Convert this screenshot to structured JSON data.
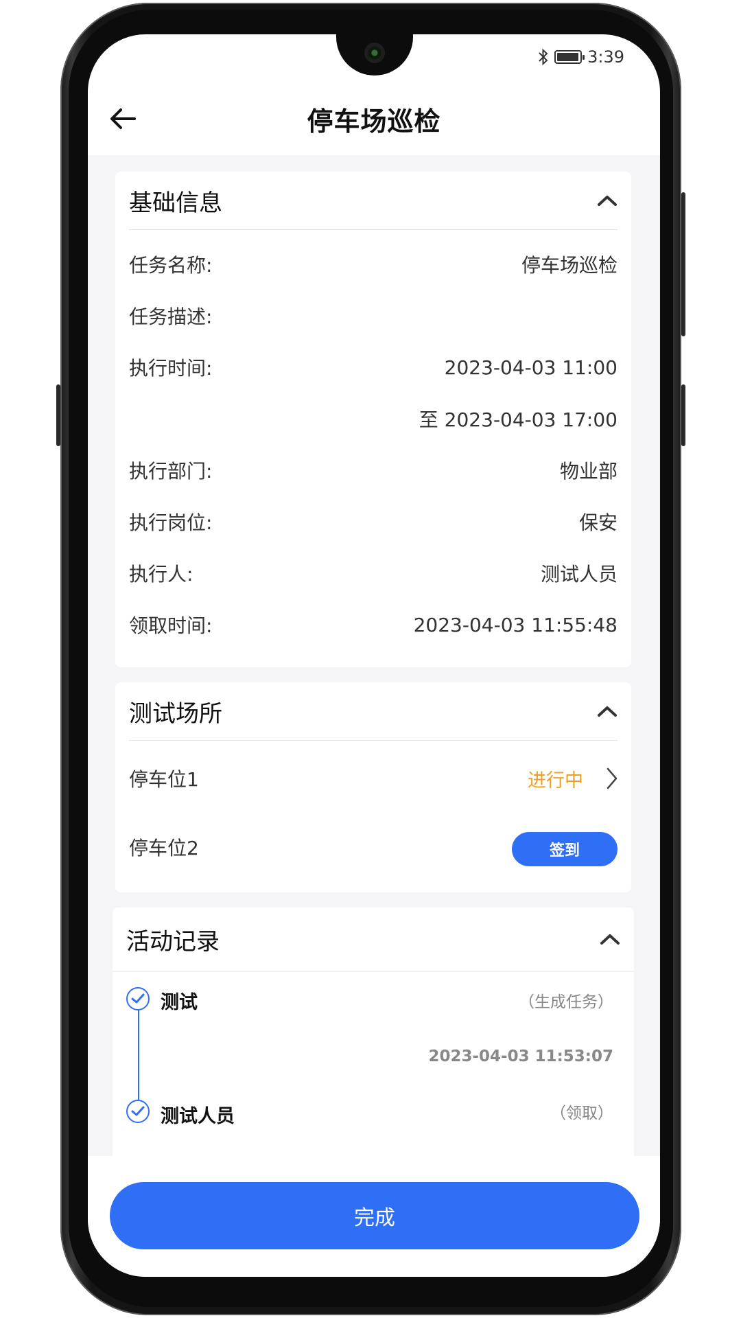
{
  "status_bar": {
    "time": "3:39",
    "bluetooth_icon": "bluetooth-icon",
    "battery_level": 0.85
  },
  "header": {
    "title": "停车场巡检",
    "back_icon": "arrow-left-icon"
  },
  "basic_info": {
    "title": "基础信息",
    "collapse_icon": "chevron-up-icon",
    "rows": [
      {
        "label": "任务名称:",
        "value": "停车场巡检"
      },
      {
        "label": "任务描述:",
        "value": ""
      },
      {
        "label": "执行时间:",
        "value": "2023-04-03 11:00"
      },
      {
        "label": "",
        "value": "至 2023-04-03 17:00"
      },
      {
        "label": "执行部门:",
        "value": "物业部"
      },
      {
        "label": "执行岗位:",
        "value": "保安"
      },
      {
        "label": "执行人:",
        "value": "测试人员"
      },
      {
        "label": "领取时间:",
        "value": "2023-04-03 11:55:48"
      }
    ]
  },
  "location": {
    "title": "测试场所",
    "collapse_icon": "chevron-up-icon",
    "items": [
      {
        "name": "停车位1",
        "status": "进行中",
        "arrow_icon": "chevron-right-icon",
        "status_color": "#f0a020"
      },
      {
        "name": "停车位2",
        "button_label": "签到"
      }
    ]
  },
  "activity": {
    "title": "活动记录",
    "collapse_icon": "chevron-up-icon",
    "records": [
      {
        "name": "测试",
        "action": "（生成任务）",
        "time": "2023-04-03 11:53:07"
      },
      {
        "name": "测试人员",
        "action": "（领取）"
      }
    ]
  },
  "footer": {
    "done_label": "完成"
  },
  "colors": {
    "accent": "#2e6ff6",
    "in_progress": "#f0a020",
    "background": "#f5f5f7"
  }
}
